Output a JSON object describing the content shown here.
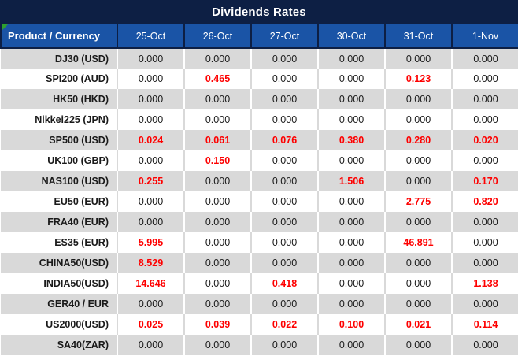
{
  "title": "Dividends Rates",
  "colors": {
    "title_bar_navy": "#0d1f44",
    "header_blue": "#1a54a6",
    "row_gray": "#d9d9d9",
    "row_white": "#ffffff",
    "value_red": "#fe0000",
    "value_black": "#1a1a1a",
    "corner_triangle_green": "#2ea02e"
  },
  "table": {
    "corner_label": "Product / Currency",
    "date_headers": [
      "25-Oct",
      "26-Oct",
      "27-Oct",
      "30-Oct",
      "31-Oct",
      "1-Nov"
    ],
    "rows": [
      {
        "product": "DJ30 (USD)",
        "values": [
          "0.000",
          "0.000",
          "0.000",
          "0.000",
          "0.000",
          "0.000"
        ],
        "red": [
          false,
          false,
          false,
          false,
          false,
          false
        ]
      },
      {
        "product": "SPI200 (AUD)",
        "values": [
          "0.000",
          "0.465",
          "0.000",
          "0.000",
          "0.123",
          "0.000"
        ],
        "red": [
          false,
          true,
          false,
          false,
          true,
          false
        ]
      },
      {
        "product": "HK50 (HKD)",
        "values": [
          "0.000",
          "0.000",
          "0.000",
          "0.000",
          "0.000",
          "0.000"
        ],
        "red": [
          false,
          false,
          false,
          false,
          false,
          false
        ]
      },
      {
        "product": "Nikkei225 (JPN)",
        "values": [
          "0.000",
          "0.000",
          "0.000",
          "0.000",
          "0.000",
          "0.000"
        ],
        "red": [
          false,
          false,
          false,
          false,
          false,
          false
        ]
      },
      {
        "product": "SP500 (USD)",
        "values": [
          "0.024",
          "0.061",
          "0.076",
          "0.380",
          "0.280",
          "0.020"
        ],
        "red": [
          true,
          true,
          true,
          true,
          true,
          true
        ]
      },
      {
        "product": "UK100 (GBP)",
        "values": [
          "0.000",
          "0.150",
          "0.000",
          "0.000",
          "0.000",
          "0.000"
        ],
        "red": [
          false,
          true,
          false,
          false,
          false,
          false
        ]
      },
      {
        "product": "NAS100 (USD)",
        "values": [
          "0.255",
          "0.000",
          "0.000",
          "1.506",
          "0.000",
          "0.170"
        ],
        "red": [
          true,
          false,
          false,
          true,
          false,
          true
        ]
      },
      {
        "product": "EU50 (EUR)",
        "values": [
          "0.000",
          "0.000",
          "0.000",
          "0.000",
          "2.775",
          "0.820"
        ],
        "red": [
          false,
          false,
          false,
          false,
          true,
          true
        ]
      },
      {
        "product": "FRA40 (EUR)",
        "values": [
          "0.000",
          "0.000",
          "0.000",
          "0.000",
          "0.000",
          "0.000"
        ],
        "red": [
          false,
          false,
          false,
          false,
          false,
          false
        ]
      },
      {
        "product": "ES35 (EUR)",
        "values": [
          "5.995",
          "0.000",
          "0.000",
          "0.000",
          "46.891",
          "0.000"
        ],
        "red": [
          true,
          false,
          false,
          false,
          true,
          false
        ]
      },
      {
        "product": "CHINA50(USD)",
        "values": [
          "8.529",
          "0.000",
          "0.000",
          "0.000",
          "0.000",
          "0.000"
        ],
        "red": [
          true,
          false,
          false,
          false,
          false,
          false
        ]
      },
      {
        "product": "INDIA50(USD)",
        "values": [
          "14.646",
          "0.000",
          "0.418",
          "0.000",
          "0.000",
          "1.138"
        ],
        "red": [
          true,
          false,
          true,
          false,
          false,
          true
        ]
      },
      {
        "product": "GER40 / EUR",
        "values": [
          "0.000",
          "0.000",
          "0.000",
          "0.000",
          "0.000",
          "0.000"
        ],
        "red": [
          false,
          false,
          false,
          false,
          false,
          false
        ]
      },
      {
        "product": "US2000(USD)",
        "values": [
          "0.025",
          "0.039",
          "0.022",
          "0.100",
          "0.021",
          "0.114"
        ],
        "red": [
          true,
          true,
          true,
          true,
          true,
          true
        ]
      },
      {
        "product": "SA40(ZAR)",
        "values": [
          "0.000",
          "0.000",
          "0.000",
          "0.000",
          "0.000",
          "0.000"
        ],
        "red": [
          false,
          false,
          false,
          false,
          false,
          false
        ]
      }
    ]
  }
}
